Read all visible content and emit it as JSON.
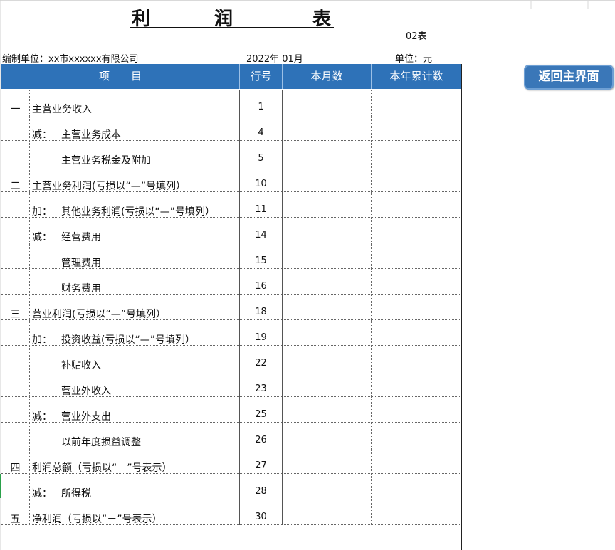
{
  "title_chars": [
    "利",
    "润",
    "表"
  ],
  "form_no": "02表",
  "meta": {
    "company": "编制单位：xx市xxxxxx有限公司",
    "period": "2022年 01月",
    "unit": "单位：元"
  },
  "header": {
    "item": "项　　目",
    "line_no": "行号",
    "this_month": "本月数",
    "year_to_date": "本年累计数"
  },
  "return_button": "返回主界面",
  "rows": [
    {
      "sec": "一",
      "prefix": "",
      "label": "主营业务收入",
      "line": "1"
    },
    {
      "sec": "",
      "prefix": "减：",
      "label": "主营业务成本",
      "line": "4"
    },
    {
      "sec": "",
      "prefix": "",
      "label": "主营业务税金及附加",
      "line": "5"
    },
    {
      "sec": "二",
      "prefix": "",
      "label": "主营业务利润(亏损以“—”号填列）",
      "line": "10"
    },
    {
      "sec": "",
      "prefix": "加：",
      "label": "其他业务利润(亏损以“—”号填列）",
      "line": "11"
    },
    {
      "sec": "",
      "prefix": "减：",
      "label": "经营费用",
      "line": "14"
    },
    {
      "sec": "",
      "prefix": "",
      "label": "管理费用",
      "line": "15"
    },
    {
      "sec": "",
      "prefix": "",
      "label": "财务费用",
      "line": "16"
    },
    {
      "sec": "三",
      "prefix": "",
      "label": "营业利润(亏损以“—”号填列）",
      "line": "18"
    },
    {
      "sec": "",
      "prefix": "加：",
      "label": "投资收益(亏损以“—”号填列）",
      "line": "19"
    },
    {
      "sec": "",
      "prefix": "",
      "label": "补贴收入",
      "line": "22"
    },
    {
      "sec": "",
      "prefix": "",
      "label": "营业外收入",
      "line": "23"
    },
    {
      "sec": "",
      "prefix": "减：",
      "label": "营业外支出",
      "line": "25"
    },
    {
      "sec": "",
      "prefix": "",
      "label": "以前年度损益调整",
      "line": "26"
    },
    {
      "sec": "四",
      "prefix": "",
      "label": "利润总额（亏损以“－”号表示）",
      "line": "27"
    },
    {
      "sec": "",
      "prefix": "减：",
      "label": "所得税",
      "line": "28"
    },
    {
      "sec": "五",
      "prefix": "",
      "label": "净利润（亏损以“－”号表示）",
      "line": "30"
    }
  ]
}
